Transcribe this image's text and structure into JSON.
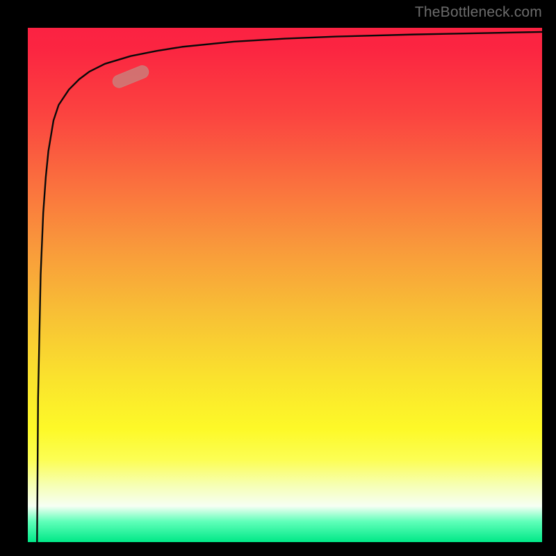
{
  "attribution": "TheBottleneck.com",
  "colors": {
    "background": "#000000",
    "attribution_text": "#6c6c6c",
    "curve_stroke": "#090909",
    "marker_fill": "#c97f7b",
    "marker_stroke": "#c97f7b",
    "gradient_stops": [
      {
        "pos": 0.0,
        "color": "#fb2242"
      },
      {
        "pos": 0.04,
        "color": "#fb2541"
      },
      {
        "pos": 0.17,
        "color": "#fb4440"
      },
      {
        "pos": 0.3,
        "color": "#fa6f3e"
      },
      {
        "pos": 0.43,
        "color": "#f99a3b"
      },
      {
        "pos": 0.56,
        "color": "#f8c135"
      },
      {
        "pos": 0.68,
        "color": "#fae22d"
      },
      {
        "pos": 0.78,
        "color": "#fdf928"
      },
      {
        "pos": 0.84,
        "color": "#fcfe54"
      },
      {
        "pos": 0.89,
        "color": "#f6ffb5"
      },
      {
        "pos": 0.93,
        "color": "#f6fff4"
      },
      {
        "pos": 0.96,
        "color": "#5fffb9"
      },
      {
        "pos": 1.0,
        "color": "#00e887"
      }
    ]
  },
  "chart_data": {
    "type": "line",
    "title": "",
    "xlabel": "",
    "ylabel": "",
    "xlim": [
      0,
      100
    ],
    "ylim": [
      0,
      100
    ],
    "grid": false,
    "legend": false,
    "note": "Axes have no visible tick labels. x and y are expressed as percentages of the plot width and height. The curve is a steep saturating (log-like) rise from bottom-left toward the top edge, flattening near y≈99. A single capsule-shaped marker highlights a point on the curve near x≈20, y≈90.",
    "curve": {
      "x": [
        1.8,
        2.0,
        2.5,
        3.0,
        3.5,
        4.0,
        5.0,
        6.0,
        8.0,
        10.0,
        12.0,
        15.0,
        20.0,
        25.0,
        30.0,
        40.0,
        50.0,
        60.0,
        75.0,
        90.0,
        100.0
      ],
      "y": [
        0.0,
        28.0,
        52.0,
        64.0,
        71.0,
        76.0,
        82.0,
        85.0,
        88.0,
        90.0,
        91.5,
        93.0,
        94.5,
        95.5,
        96.3,
        97.3,
        97.9,
        98.3,
        98.7,
        99.0,
        99.2
      ]
    },
    "marker": {
      "x": 20.0,
      "y": 90.5,
      "angle_deg_from_horizontal": 22
    }
  }
}
